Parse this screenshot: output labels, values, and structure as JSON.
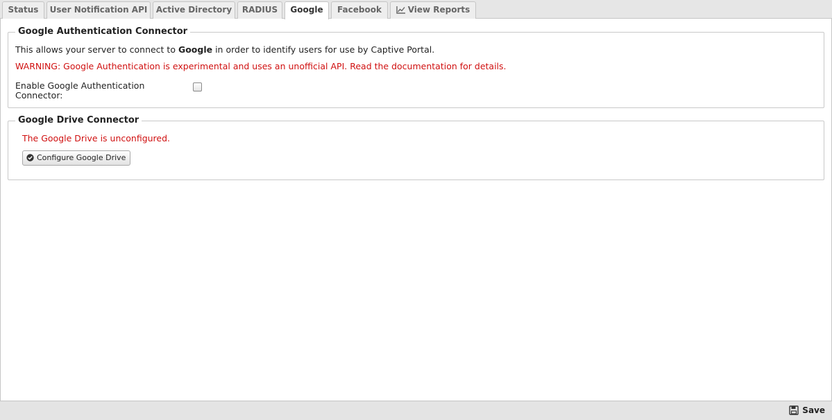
{
  "tabs": [
    {
      "label": "Status"
    },
    {
      "label": "User Notification API"
    },
    {
      "label": "Active Directory"
    },
    {
      "label": "RADIUS"
    },
    {
      "label": "Google",
      "active": true
    },
    {
      "label": "Facebook"
    },
    {
      "label": "View Reports",
      "icon": "line-chart-icon"
    }
  ],
  "google_auth": {
    "title": "Google Authentication Connector",
    "intro_prefix": "This allows your server to connect to ",
    "intro_bold": "Google",
    "intro_suffix": " in order to identify users for use by Captive Portal.",
    "warning": "WARNING: Google Authentication is experimental and uses an unofficial API. Read the documentation for details.",
    "enable_label_line1": "Enable Google Authentication",
    "enable_label_line2": "Connector:",
    "enabled": false
  },
  "google_drive": {
    "title": "Google Drive Connector",
    "status": "The Google Drive is unconfigured.",
    "configure_label": "Configure Google Drive",
    "configure_icon": "check-circle-icon"
  },
  "footer": {
    "save_label": "Save",
    "save_icon": "floppy-disk-icon"
  },
  "colors": {
    "warning": "#d01010",
    "tabbar_bg": "#e6e6e6",
    "footer_bg": "#e4e4e4"
  }
}
